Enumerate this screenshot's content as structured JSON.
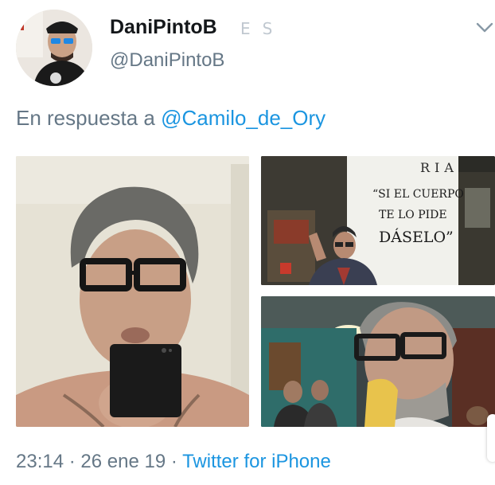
{
  "user": {
    "display_name": "DaniPintoB",
    "flag_letters": [
      "E",
      "S"
    ],
    "handle": "@DaniPintoB"
  },
  "reply": {
    "prefix": "En respuesta a",
    "mention": "@Camilo_de_Ory"
  },
  "media": {
    "sign_text": {
      "top": "RIA",
      "line1": "“SI EL CUERPO",
      "line2": "TE LO PIDE",
      "line3": "DÁSELO”"
    }
  },
  "meta": {
    "time": "23:14",
    "sep": "·",
    "date": "26 ene 19",
    "source": "Twitter for iPhone"
  },
  "colors": {
    "link": "#1b95e0",
    "secondary": "#657786",
    "primary": "#14171a"
  },
  "icons": [
    "chevron-down-icon"
  ]
}
